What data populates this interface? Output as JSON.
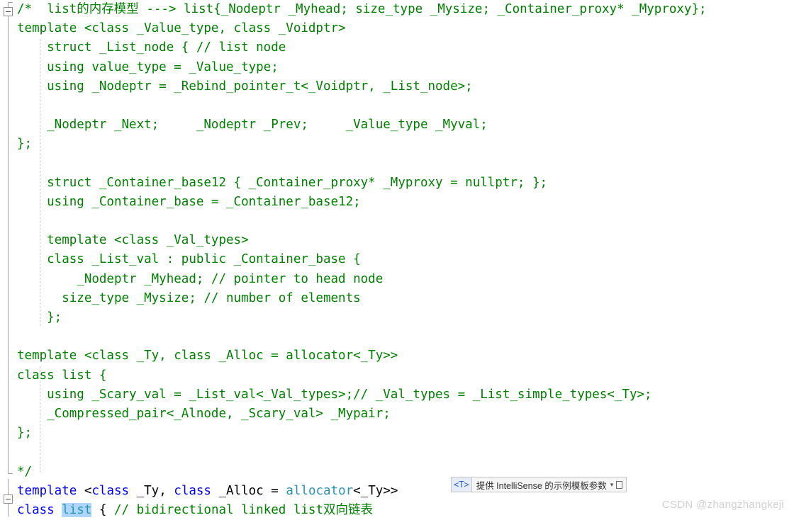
{
  "app": {
    "kind": "code-editor",
    "language": "C++",
    "theme": "light"
  },
  "colors": {
    "background": "#ffffff",
    "comment": "#008000",
    "keyword": "#0000ff",
    "type": "#2b91af",
    "punctuation": "#000000",
    "selection": "#add6ff",
    "gutter_line": "#a0a0a0",
    "indent_guide": "#c3c3c3",
    "watermark": "#d0d0d0"
  },
  "gutter": {
    "collapse_icon_top": "collapse-minus-box",
    "collapse_icon_bottom": "collapse-minus-box"
  },
  "code": {
    "lines": [
      {
        "n": 1,
        "segments": [
          {
            "t": "/*  list的内存模型 ---> list{_Nodeptr _Myhead; size_type _Mysize; _Container_proxy* _Myproxy};",
            "c": "cmt"
          }
        ]
      },
      {
        "n": 2,
        "segments": [
          {
            "t": "template <class _Value_type, class _Voidptr>",
            "c": "cmt"
          }
        ]
      },
      {
        "n": 3,
        "segments": [
          {
            "t": "    struct _List_node { // list node",
            "c": "cmt"
          }
        ]
      },
      {
        "n": 4,
        "segments": [
          {
            "t": "    using value_type = _Value_type;",
            "c": "cmt"
          }
        ]
      },
      {
        "n": 5,
        "segments": [
          {
            "t": "    using _Nodeptr = _Rebind_pointer_t<_Voidptr, _List_node>;",
            "c": "cmt"
          }
        ]
      },
      {
        "n": 6,
        "segments": [
          {
            "t": "",
            "c": "cmt"
          }
        ]
      },
      {
        "n": 7,
        "segments": [
          {
            "t": "    _Nodeptr _Next;     _Nodeptr _Prev;     _Value_type _Myval;",
            "c": "cmt"
          }
        ]
      },
      {
        "n": 8,
        "segments": [
          {
            "t": "};",
            "c": "cmt"
          }
        ]
      },
      {
        "n": 9,
        "segments": [
          {
            "t": "",
            "c": "cmt"
          }
        ]
      },
      {
        "n": 10,
        "segments": [
          {
            "t": "    struct _Container_base12 { _Container_proxy* _Myproxy = nullptr; };",
            "c": "cmt"
          }
        ]
      },
      {
        "n": 11,
        "segments": [
          {
            "t": "    using _Container_base = _Container_base12;",
            "c": "cmt"
          }
        ]
      },
      {
        "n": 12,
        "segments": [
          {
            "t": "",
            "c": "cmt"
          }
        ]
      },
      {
        "n": 13,
        "segments": [
          {
            "t": "    template <class _Val_types>",
            "c": "cmt"
          }
        ]
      },
      {
        "n": 14,
        "segments": [
          {
            "t": "    class _List_val : public _Container_base {",
            "c": "cmt"
          }
        ]
      },
      {
        "n": 15,
        "segments": [
          {
            "t": "        _Nodeptr _Myhead; // pointer to head node",
            "c": "cmt"
          }
        ]
      },
      {
        "n": 16,
        "segments": [
          {
            "t": "      size_type _Mysize; // number of elements",
            "c": "cmt"
          }
        ]
      },
      {
        "n": 17,
        "segments": [
          {
            "t": "    };",
            "c": "cmt"
          }
        ]
      },
      {
        "n": 18,
        "segments": [
          {
            "t": "",
            "c": "cmt"
          }
        ]
      },
      {
        "n": 19,
        "segments": [
          {
            "t": "template <class _Ty, class _Alloc = allocator<_Ty>>",
            "c": "cmt"
          }
        ]
      },
      {
        "n": 20,
        "segments": [
          {
            "t": "class list {",
            "c": "cmt"
          }
        ]
      },
      {
        "n": 21,
        "segments": [
          {
            "t": "    using _Scary_val = _List_val<_Val_types>;// _Val_types = _List_simple_types<_Ty>;",
            "c": "cmt"
          }
        ]
      },
      {
        "n": 22,
        "segments": [
          {
            "t": "    _Compressed_pair<_Alnode, _Scary_val> _Mypair;",
            "c": "cmt"
          }
        ]
      },
      {
        "n": 23,
        "segments": [
          {
            "t": "};",
            "c": "cmt"
          }
        ]
      },
      {
        "n": 24,
        "segments": [
          {
            "t": "",
            "c": "cmt"
          }
        ]
      },
      {
        "n": 25,
        "segments": [
          {
            "t": "*/",
            "c": "cmt"
          }
        ]
      },
      {
        "n": 26,
        "segments": [
          {
            "t": "template ",
            "c": "kw"
          },
          {
            "t": "<",
            "c": "punc"
          },
          {
            "t": "class ",
            "c": "kw"
          },
          {
            "t": "_Ty",
            "c": "punc"
          },
          {
            "t": ", ",
            "c": "punc"
          },
          {
            "t": "class ",
            "c": "kw"
          },
          {
            "t": "_Alloc ",
            "c": "punc"
          },
          {
            "t": "= ",
            "c": "punc"
          },
          {
            "t": "allocator",
            "c": "type"
          },
          {
            "t": "<_Ty>>",
            "c": "punc"
          }
        ]
      },
      {
        "n": 27,
        "segments": [
          {
            "t": "class ",
            "c": "kw"
          },
          {
            "t": "list",
            "c": "type sel"
          },
          {
            "t": " { ",
            "c": "punc"
          },
          {
            "t": "// bidirectional linked list双向链表",
            "c": "cmt"
          }
        ]
      }
    ]
  },
  "intellisense": {
    "tag": "<T>",
    "text": "提供 IntelliSense 的示例模板参数",
    "caret": "▾",
    "chip_icon": "pin-square-icon"
  },
  "watermark": {
    "text": "CSDN @zhangzhangkeji"
  }
}
